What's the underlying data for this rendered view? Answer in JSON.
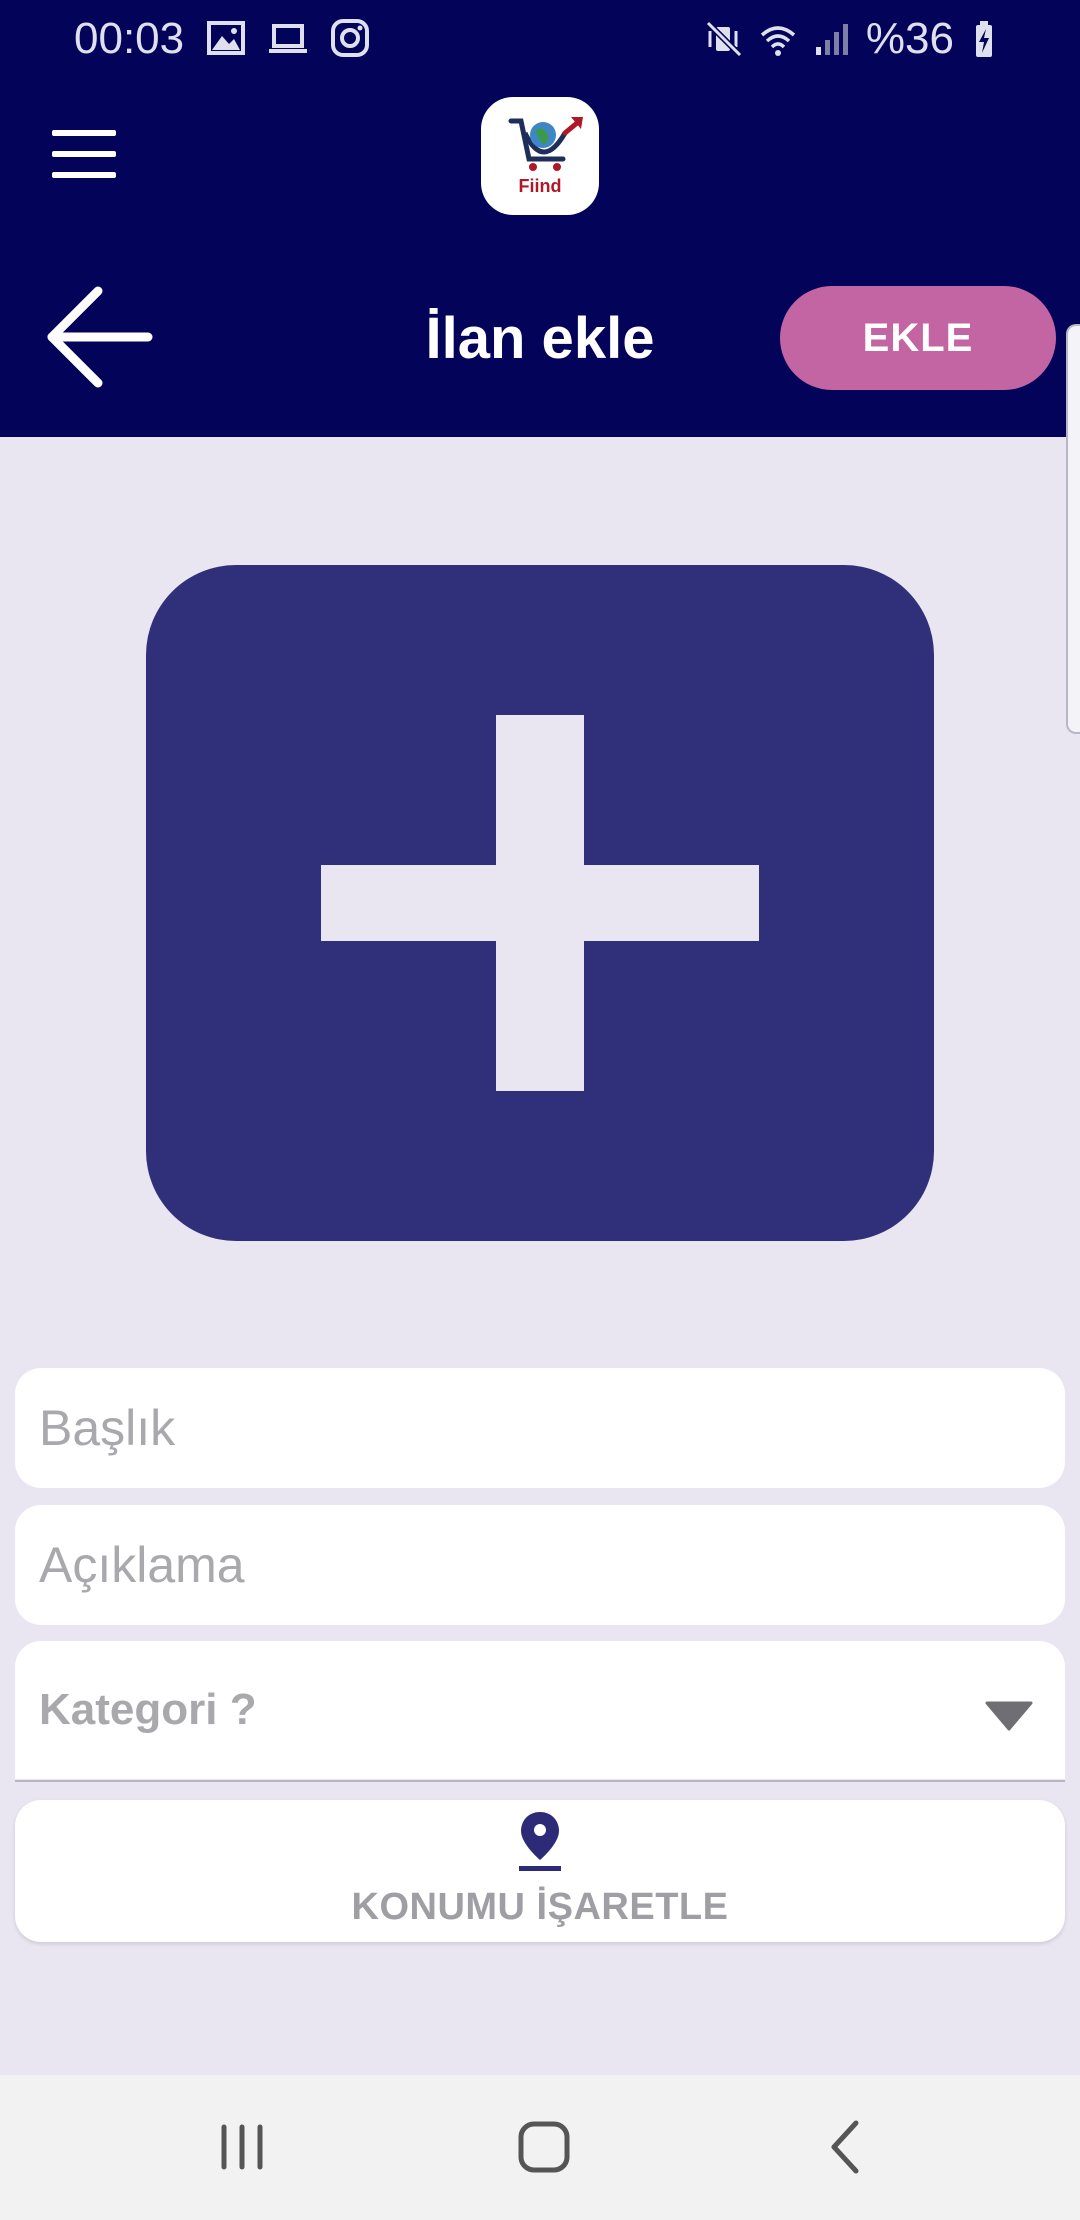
{
  "status_bar": {
    "time": "00:03",
    "battery": "%36",
    "left_icons": [
      "gallery-icon",
      "laptop-icon",
      "instagram-icon"
    ],
    "right_icons": [
      "mute-vibrate-icon",
      "wifi-icon",
      "signal-icon",
      "battery-charging-icon"
    ]
  },
  "header": {
    "logo_text": "Fiind",
    "title": "İlan ekle",
    "add_button_label": "EKLE",
    "colors": {
      "bar": "#03035a",
      "button": "#c265a2"
    }
  },
  "image_picker": {
    "icon": "plus-icon",
    "color": "#302f79"
  },
  "form": {
    "title_placeholder": "Başlık",
    "description_placeholder": "Açıklama",
    "category_placeholder": "Kategori ?",
    "location_button_label": "KONUMU İŞARETLE"
  },
  "nav_bar": {
    "buttons": [
      "recent-apps-icon",
      "home-icon",
      "back-nav-icon"
    ]
  }
}
